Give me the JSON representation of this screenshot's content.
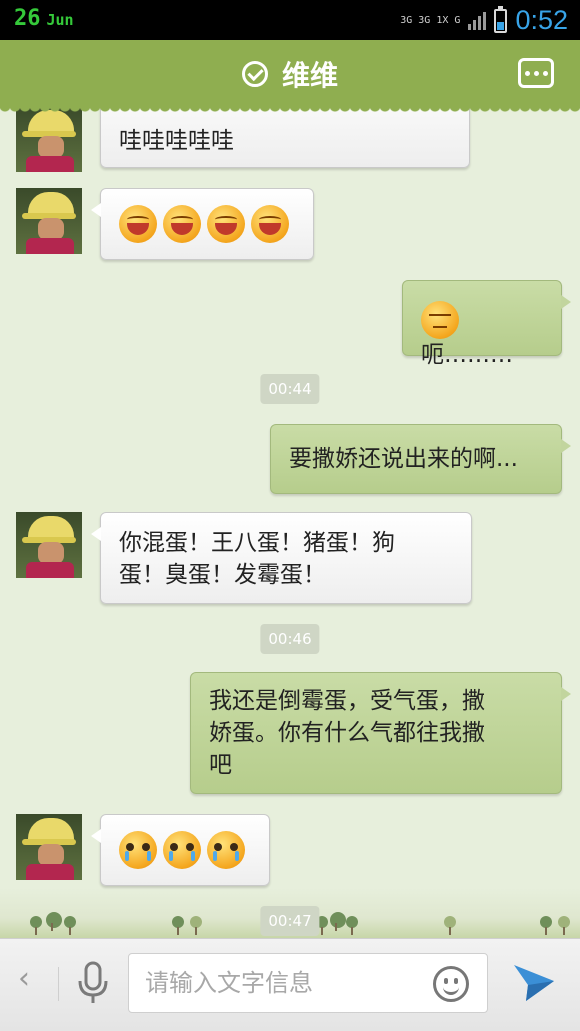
{
  "status_bar": {
    "date_day": "26",
    "date_month": "Jun",
    "network_label_1": "3G",
    "network_label_2": "3G 1X",
    "network_label_3": "G",
    "time": "0:52"
  },
  "header": {
    "title": "维维",
    "verified_icon": "check-circle-icon",
    "more_icon": "ellipsis-icon"
  },
  "messages": [
    {
      "side": "in",
      "text": "哇哇哇哇哇"
    },
    {
      "side": "in",
      "emojis": [
        "laugh",
        "laugh",
        "laugh",
        "laugh"
      ]
    },
    {
      "side": "out",
      "emoji": "meh",
      "text": "呃………"
    },
    {
      "timestamp": "00:44"
    },
    {
      "side": "out",
      "text": "要撒娇还说出来的啊..."
    },
    {
      "side": "in",
      "lines": [
        "你混蛋！王八蛋！猪蛋！狗",
        "蛋！臭蛋！发霉蛋！"
      ]
    },
    {
      "timestamp": "00:46"
    },
    {
      "side": "out",
      "lines": [
        "我还是倒霉蛋，受气蛋，撒",
        "娇蛋。你有什么气都往我撒",
        "吧"
      ]
    },
    {
      "side": "in",
      "emojis": [
        "cry",
        "cry",
        "cry"
      ]
    },
    {
      "timestamp": "00:47"
    }
  ],
  "input_bar": {
    "placeholder": "请输入文字信息",
    "back_icon": "chevron-left-icon",
    "mic_icon": "microphone-icon",
    "emoji_icon": "smiley-icon",
    "send_icon": "send-icon"
  },
  "colors": {
    "header": "#8fae50",
    "outgoing_bubble": "#c2d59e",
    "incoming_bubble": "#ffffff",
    "chat_background": "#e7efdc",
    "status_time": "#38a4e8",
    "status_date": "#35c93a"
  }
}
